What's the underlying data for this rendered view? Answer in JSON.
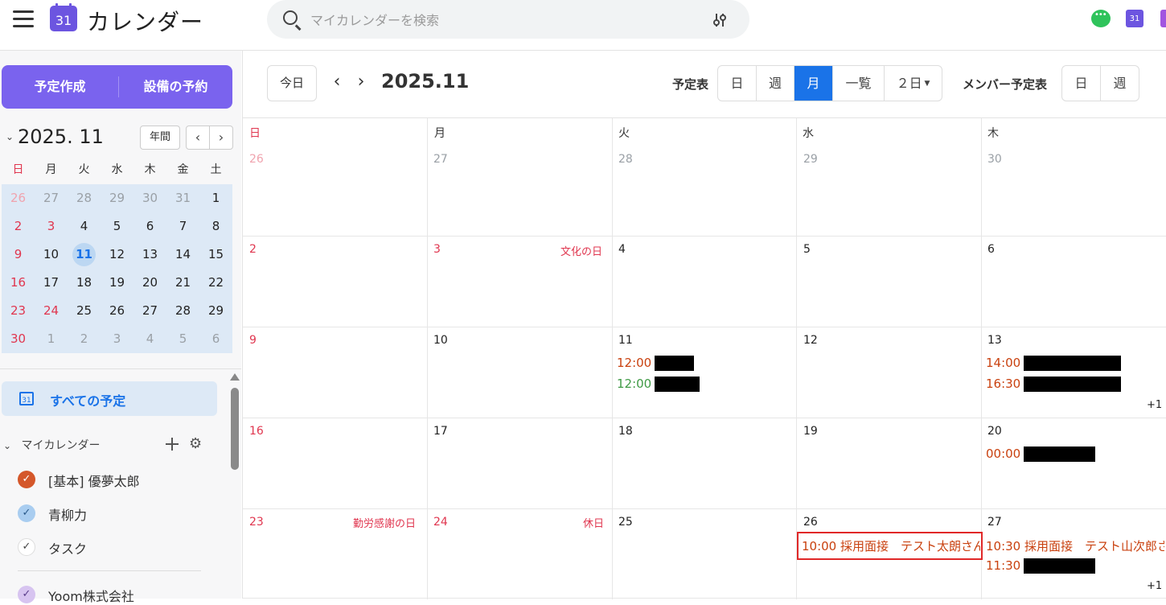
{
  "app": {
    "title": "カレンダー",
    "logo_text": "31"
  },
  "search": {
    "placeholder": "マイカレンダーを検索"
  },
  "header_icons": {
    "chat": "chat-icon",
    "calendar_app": "31"
  },
  "sidebar": {
    "create_label": "予定作成",
    "facility_label": "設備の予約",
    "mini_calendar": {
      "title": "2025. 11",
      "year_button": "年間",
      "weekdays": [
        "日",
        "月",
        "火",
        "水",
        "木",
        "金",
        "土"
      ],
      "weeks": [
        [
          "26",
          "27",
          "28",
          "29",
          "30",
          "31",
          "1"
        ],
        [
          "2",
          "3",
          "4",
          "5",
          "6",
          "7",
          "8"
        ],
        [
          "9",
          "10",
          "11",
          "12",
          "13",
          "14",
          "15"
        ],
        [
          "16",
          "17",
          "18",
          "19",
          "20",
          "21",
          "22"
        ],
        [
          "23",
          "24",
          "25",
          "26",
          "27",
          "28",
          "29"
        ],
        [
          "30",
          "1",
          "2",
          "3",
          "4",
          "5",
          "6"
        ]
      ],
      "today": "11"
    },
    "all_events_label": "すべての予定",
    "my_calendars_label": "マイカレンダー",
    "calendars": [
      {
        "name": "[基本] 優夢太郎",
        "color": "#d4572a"
      },
      {
        "name": "青柳力",
        "color": "#a9cdf0"
      },
      {
        "name": "タスク",
        "color": "#ffffff"
      },
      {
        "name": "Yoom株式会社",
        "color": "#d7c4f0"
      }
    ]
  },
  "toolbar": {
    "today": "今日",
    "title": "2025.11",
    "schedule_label": "予定表",
    "views": [
      "日",
      "週",
      "月",
      "一覧",
      "２日"
    ],
    "active_view": "月",
    "member_label": "メンバー予定表",
    "member_views": [
      "日",
      "週"
    ]
  },
  "grid": {
    "weekdays": [
      "日",
      "月",
      "火",
      "水",
      "木"
    ],
    "weeks": [
      {
        "days": [
          "26",
          "27",
          "28",
          "29",
          "30"
        ]
      },
      {
        "days": [
          "2",
          "3",
          "4",
          "5",
          "6"
        ],
        "holidays": {
          "1": "文化の日"
        }
      },
      {
        "days": [
          "9",
          "10",
          "11",
          "12",
          "13"
        ]
      },
      {
        "days": [
          "16",
          "17",
          "18",
          "19",
          "20"
        ]
      },
      {
        "days": [
          "23",
          "24",
          "25",
          "26",
          "27"
        ],
        "holidays": {
          "0": "勤労感謝の日",
          "1": "休日"
        }
      }
    ],
    "events": {
      "w2d2a": "12:00",
      "w2d2b": "12:00",
      "w2d4a": "14:00",
      "w2d4b": "16:30",
      "w2d4more": "+1",
      "w3d4a": "00:00",
      "w4d3a": "10:00 採用面接　テスト太朗さん",
      "w4d4a": "10:30 採用面接　テスト山次郎さ",
      "w4d4b": "11:30",
      "w4d4more": "+1"
    }
  },
  "colors": {
    "accent": "#1a73e8",
    "create": "#7a63ee",
    "holiday": "#e0364f",
    "event_red": "#c9410f",
    "event_green": "#3f9a45"
  }
}
